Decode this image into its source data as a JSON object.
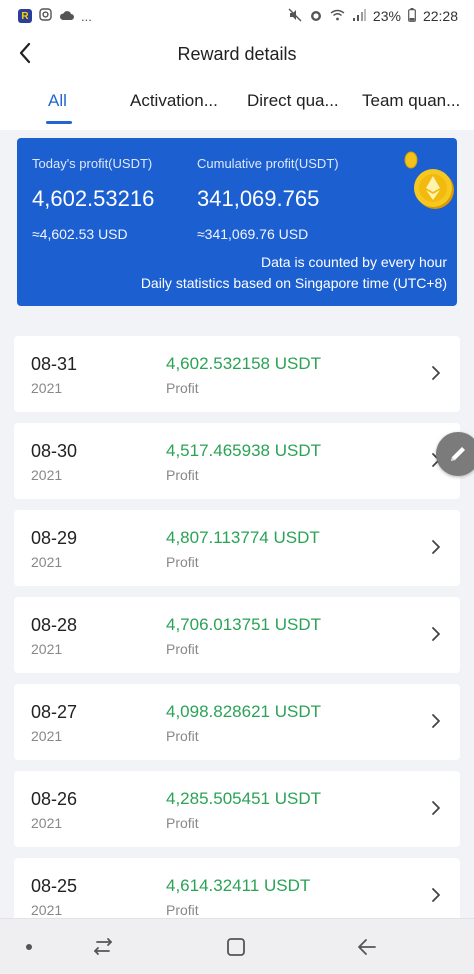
{
  "status_bar": {
    "app_badge": "R",
    "dots": "...",
    "battery": "23%",
    "time": "22:28"
  },
  "header": {
    "title": "Reward details"
  },
  "tabs": [
    {
      "label": "All",
      "active": true
    },
    {
      "label": "Activation..."
    },
    {
      "label": "Direct qua..."
    },
    {
      "label": "Team quan..."
    }
  ],
  "summary": {
    "today_label": "Today's profit(USDT)",
    "today_value": "4,602.53216",
    "today_usd": "≈4,602.53 USD",
    "cumulative_label": "Cumulative profit(USDT)",
    "cumulative_value": "341,069.765",
    "cumulative_usd": "≈341,069.76 USD",
    "note_line1": "Data is counted by every hour",
    "note_line2": "Daily statistics based on Singapore time (UTC+8)"
  },
  "records": [
    {
      "date": "08-31",
      "year": "2021",
      "amount": "4,602.532158 USDT",
      "type": "Profit"
    },
    {
      "date": "08-30",
      "year": "2021",
      "amount": "4,517.465938 USDT",
      "type": "Profit"
    },
    {
      "date": "08-29",
      "year": "2021",
      "amount": "4,807.113774 USDT",
      "type": "Profit"
    },
    {
      "date": "08-28",
      "year": "2021",
      "amount": "4,706.013751 USDT",
      "type": "Profit"
    },
    {
      "date": "08-27",
      "year": "2021",
      "amount": "4,098.828621 USDT",
      "type": "Profit"
    },
    {
      "date": "08-26",
      "year": "2021",
      "amount": "4,285.505451 USDT",
      "type": "Profit"
    },
    {
      "date": "08-25",
      "year": "2021",
      "amount": "4,614.32411 USDT",
      "type": "Profit"
    }
  ],
  "colors": {
    "accent": "#2366d1",
    "banner": "#1c5fd0",
    "profit_green": "#2aa355"
  },
  "icons": {
    "back": "back-arrow-icon",
    "row_arrow": "chevron-right-icon",
    "coin": "gold-coin-icon",
    "edit": "pencil-icon"
  }
}
